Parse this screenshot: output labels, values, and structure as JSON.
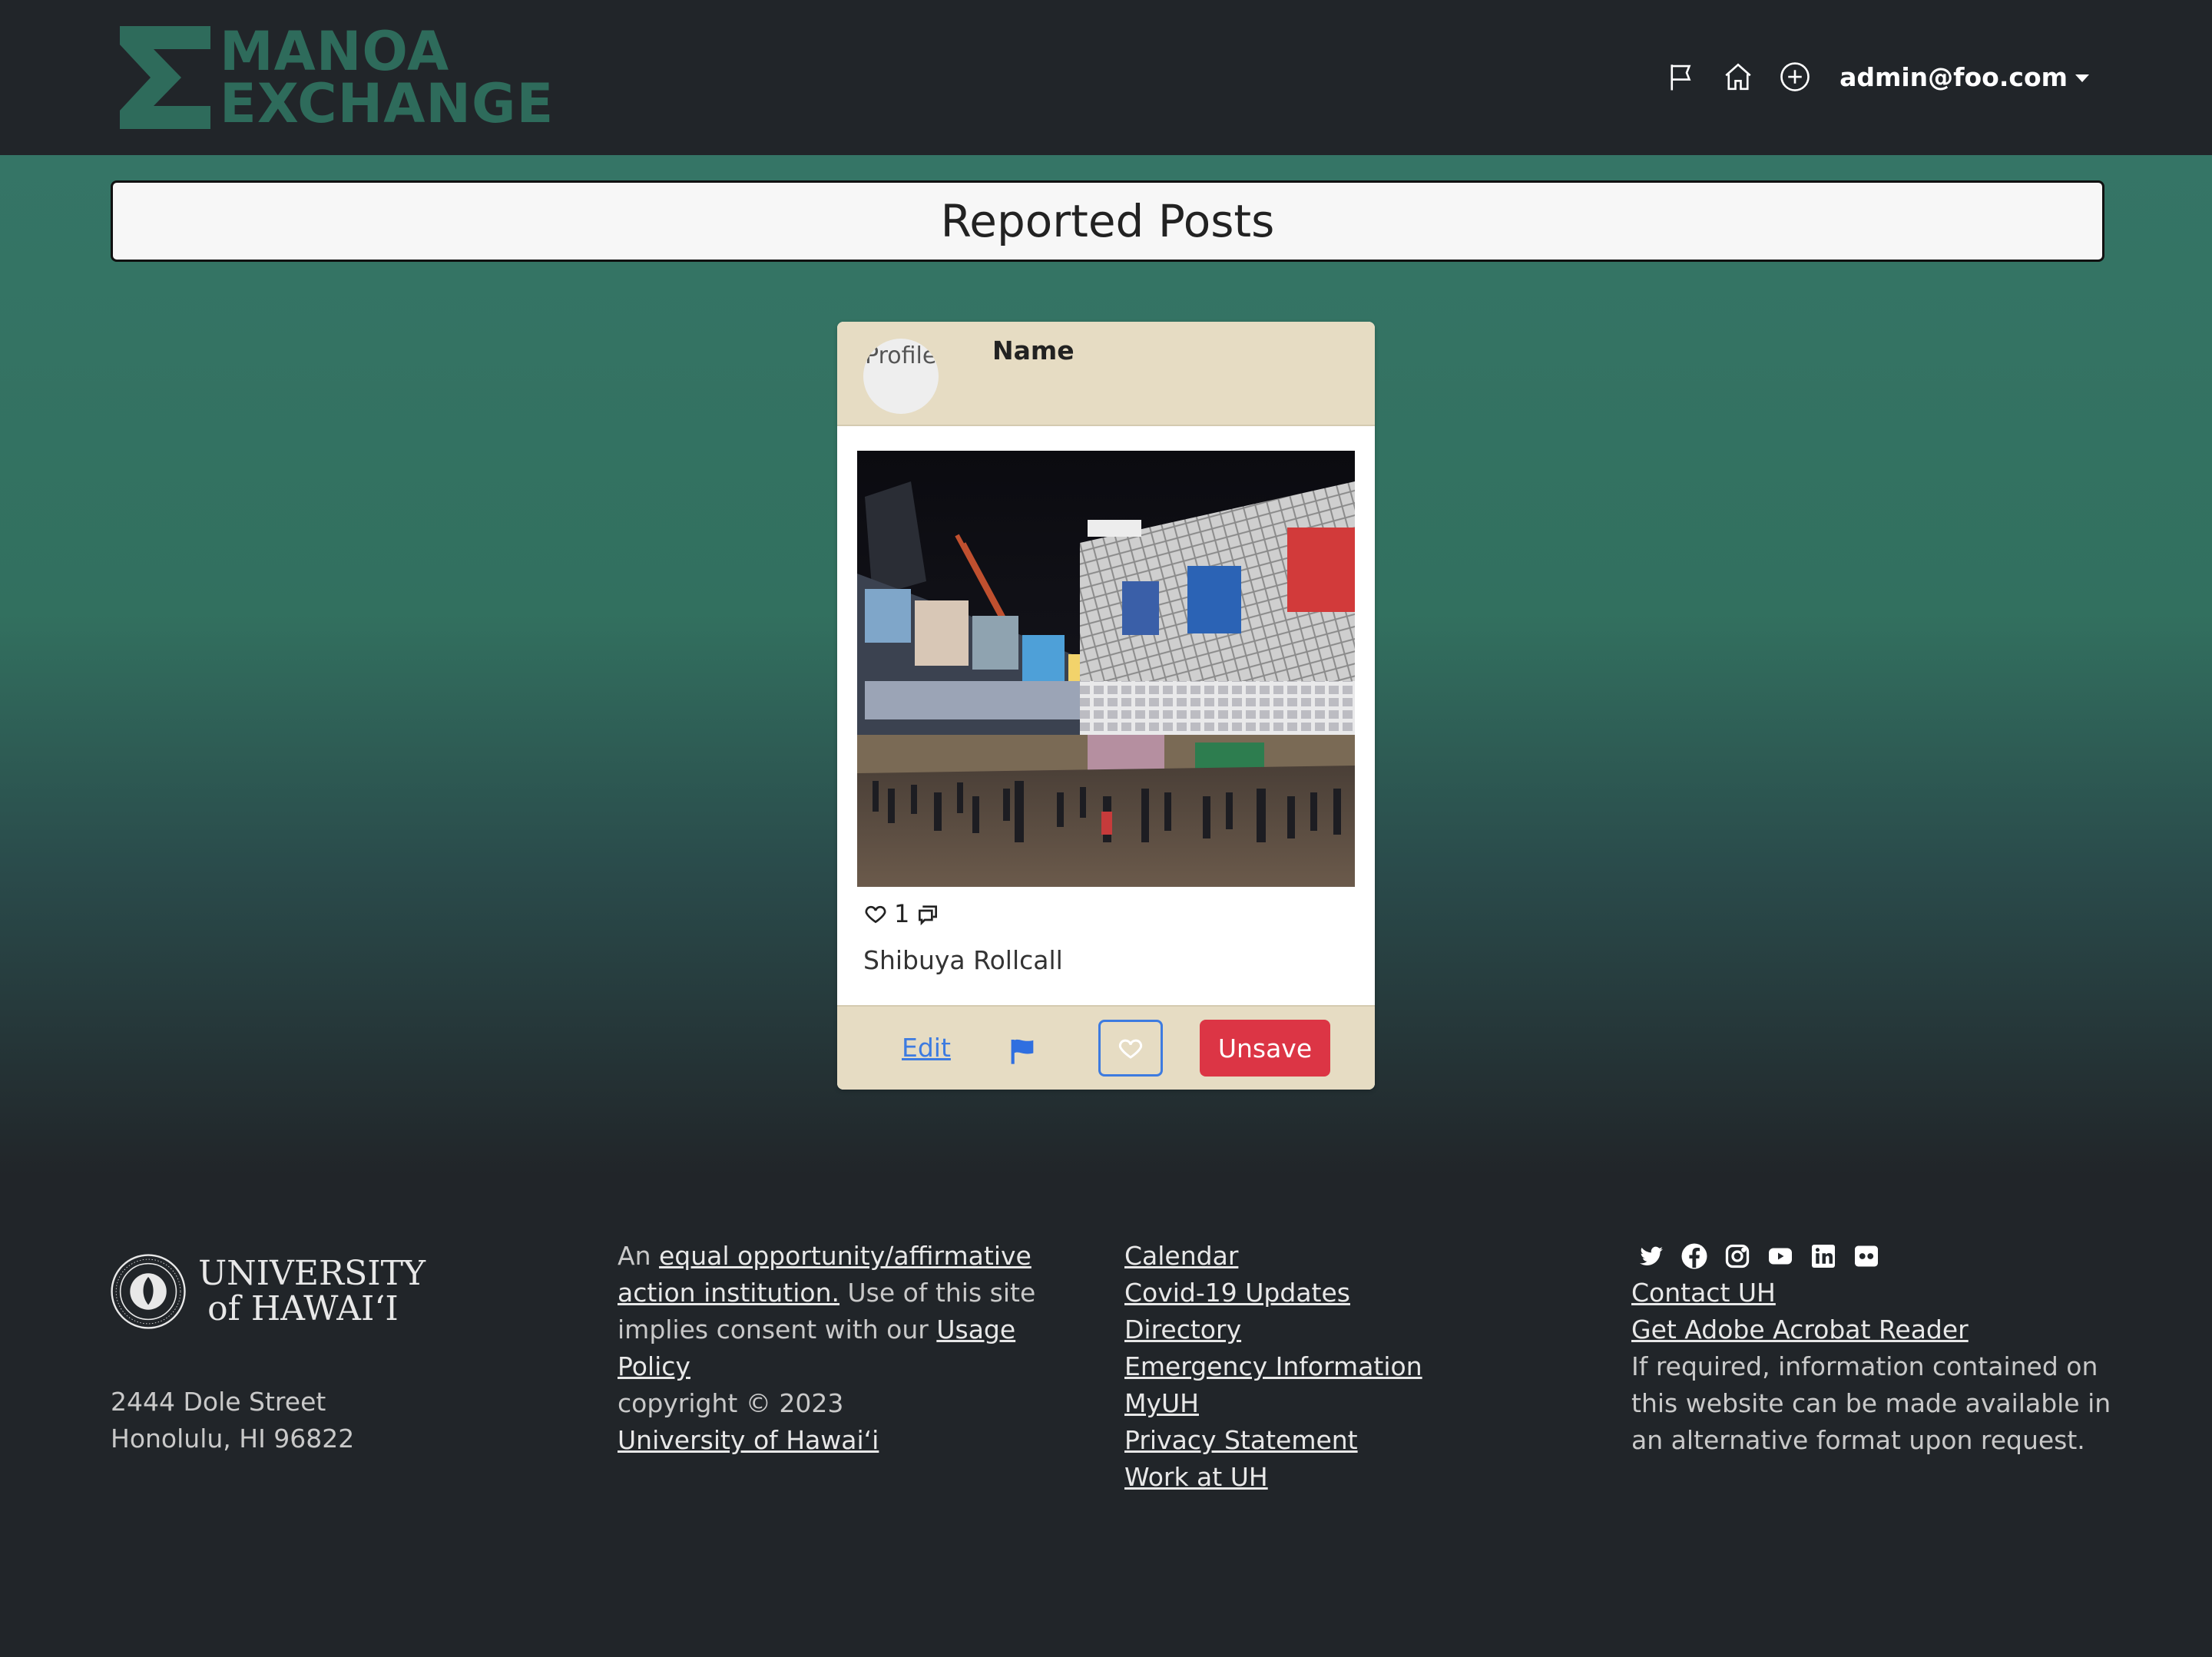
{
  "navbar": {
    "brand_line1": "MANOA",
    "brand_line2": "EXCHANGE",
    "icons": [
      "flag-icon",
      "home-icon",
      "plus-circle-icon"
    ],
    "user_email": "admin@foo.com"
  },
  "page": {
    "title": "Reported Posts"
  },
  "post": {
    "avatar_alt": "Profile",
    "author_name": "Name",
    "likes_count": "1",
    "caption": "Shibuya Rollcall",
    "edit_label": "Edit",
    "unsave_label": "Unsave"
  },
  "footer": {
    "university_line1": "UNIVERSITY",
    "university_line2": "of HAWAIʻI",
    "address_line1": "2444 Dole Street",
    "address_line2": "Honolulu, HI 96822",
    "statement_prefix": "An ",
    "equal_opportunity_link": "equal opportunity/affirmative action institution.",
    "statement_middle": " Use of this site implies consent with our ",
    "usage_policy_link": "Usage Policy",
    "copyright": "copyright © 2023",
    "university_link": "University of Hawaiʻi",
    "links": [
      "Calendar",
      "Covid-19 Updates",
      "Directory",
      "Emergency Information",
      "MyUH",
      "Privacy Statement",
      "Work at UH"
    ],
    "social_icons": [
      "twitter-icon",
      "facebook-icon",
      "instagram-icon",
      "youtube-icon",
      "linkedin-icon",
      "flickr-icon"
    ],
    "contact_link": "Contact UH",
    "acrobat_link": "Get Adobe Acrobat Reader",
    "accessibility_note": "If required, information contained on this website can be made available in an alternative format upon request."
  },
  "colors": {
    "navbar_bg": "#212529",
    "brand_green": "#2e6b5b",
    "card_tan": "#e6dcc3",
    "unsave_red": "#dc3545",
    "link_blue": "#3d7be0"
  }
}
